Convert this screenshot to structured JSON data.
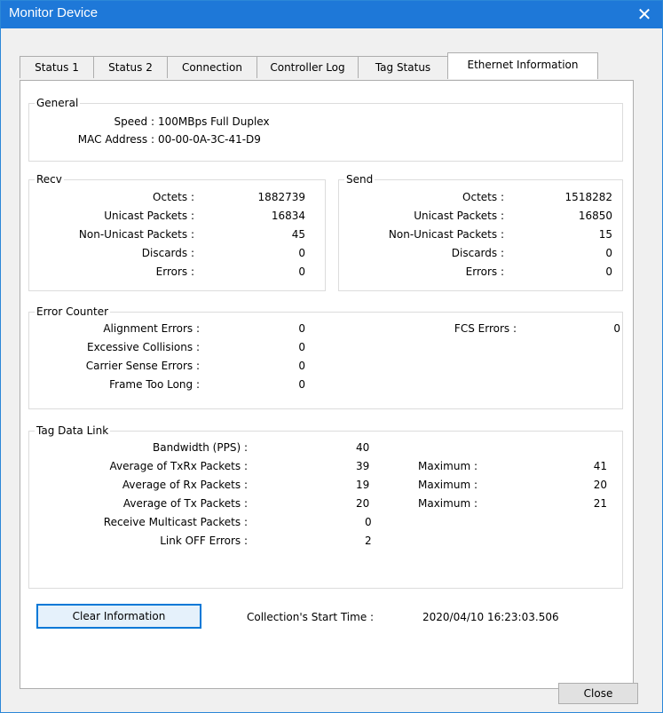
{
  "window": {
    "title": "Monitor Device",
    "close_glyph": "✕"
  },
  "tabs": [
    {
      "label": "Status 1"
    },
    {
      "label": "Status 2"
    },
    {
      "label": "Connection"
    },
    {
      "label": "Controller Log"
    },
    {
      "label": "Tag Status"
    },
    {
      "label": "Ethernet Information"
    }
  ],
  "general": {
    "title": "General",
    "speed_label": "Speed :",
    "speed_value": "100MBps Full Duplex",
    "mac_label": "MAC Address :",
    "mac_value": "00-00-0A-3C-41-D9"
  },
  "recv": {
    "title": "Recv",
    "rows": [
      {
        "label": "Octets :",
        "value": "1882739"
      },
      {
        "label": "Unicast Packets :",
        "value": "16834"
      },
      {
        "label": "Non-Unicast Packets :",
        "value": "45"
      },
      {
        "label": "Discards :",
        "value": "0"
      },
      {
        "label": "Errors :",
        "value": "0"
      }
    ]
  },
  "send": {
    "title": "Send",
    "rows": [
      {
        "label": "Octets :",
        "value": "1518282"
      },
      {
        "label": "Unicast Packets :",
        "value": "16850"
      },
      {
        "label": "Non-Unicast Packets :",
        "value": "15"
      },
      {
        "label": "Discards :",
        "value": "0"
      },
      {
        "label": "Errors :",
        "value": "0"
      }
    ]
  },
  "error_counter": {
    "title": "Error Counter",
    "rows": [
      {
        "label": "Alignment Errors :",
        "value": "0"
      },
      {
        "label": "Excessive Collisions :",
        "value": "0"
      },
      {
        "label": "Carrier Sense Errors :",
        "value": "0"
      },
      {
        "label": "Frame Too Long :",
        "value": "0"
      }
    ],
    "fcs_label": "FCS Errors :",
    "fcs_value": "0"
  },
  "tag_data_link": {
    "title": "Tag Data Link",
    "rows": [
      {
        "label": "Bandwidth (PPS) :",
        "value": "40",
        "max_label": "",
        "max_value": ""
      },
      {
        "label": "Average of TxRx Packets :",
        "value": "39",
        "max_label": "Maximum :",
        "max_value": "41"
      },
      {
        "label": "Average of Rx Packets :",
        "value": "19",
        "max_label": "Maximum :",
        "max_value": "20"
      },
      {
        "label": "Average of Tx Packets :",
        "value": "20",
        "max_label": "Maximum :",
        "max_value": "21"
      },
      {
        "label": "Receive Multicast Packets :",
        "value": "0",
        "max_label": "",
        "max_value": ""
      },
      {
        "label": "Link OFF Errors :",
        "value": "2",
        "max_label": "",
        "max_value": ""
      }
    ]
  },
  "footer": {
    "clear_button": "Clear Information",
    "start_time_label": "Collection's Start Time :",
    "start_time_value": "2020/04/10 16:23:03.506"
  },
  "close_button": "Close",
  "colors": {
    "titlebar": "#1e78d8",
    "focus_border": "#0078d7"
  }
}
